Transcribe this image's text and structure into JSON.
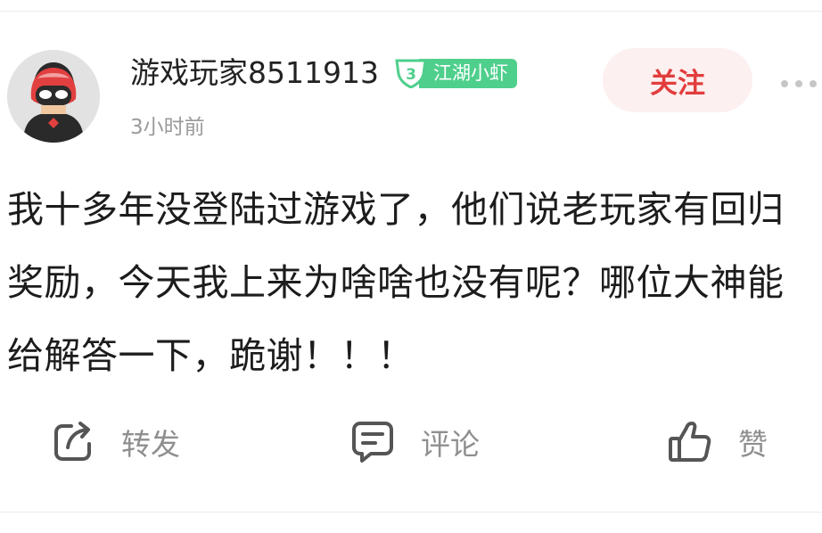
{
  "post": {
    "author": {
      "username": "游戏玩家8511913",
      "level_number": "3",
      "level_title": "江湖小虾",
      "avatar_icon": "masked-character-avatar"
    },
    "time": "3小时前",
    "follow_label": "关注",
    "more_icon": "more-dots-icon",
    "content": "我十多年没登陆过游戏了，他们说老玩家有回归奖励，今天我上来为啥啥也没有呢？哪位大神能给解答一下，跪谢！！！"
  },
  "actions": {
    "share_label": "转发",
    "comment_label": "评论",
    "like_label": "赞"
  },
  "colors": {
    "follow_text": "#e23d3d",
    "follow_bg": "#fdf0f0",
    "badge_green": "#4fcf8c",
    "secondary_text": "#9a9a9a",
    "action_text": "#8f8f8f"
  }
}
